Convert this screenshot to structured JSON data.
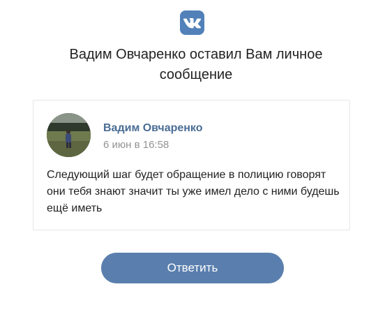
{
  "brand": {
    "logo_icon": "vk-logo-icon",
    "logo_text": "VK",
    "brand_color": "#5181b8"
  },
  "headline": "Вадим Овчаренко оставил Вам личное сообщение",
  "message": {
    "sender_name": "Вадим Овчаренко",
    "sent_time": "6 июн в 16:58",
    "text": "Следующий шаг будет обращение в полицию говорят они тебя знают значит ты уже имел дело с ними будешь ещё иметь",
    "avatar_icon": "avatar-photo"
  },
  "actions": {
    "reply_label": "Ответить"
  },
  "colors": {
    "accent": "#5a7fae",
    "sender_name": "#4a6d95",
    "muted": "#939393",
    "card_border": "#e4e6ea"
  }
}
